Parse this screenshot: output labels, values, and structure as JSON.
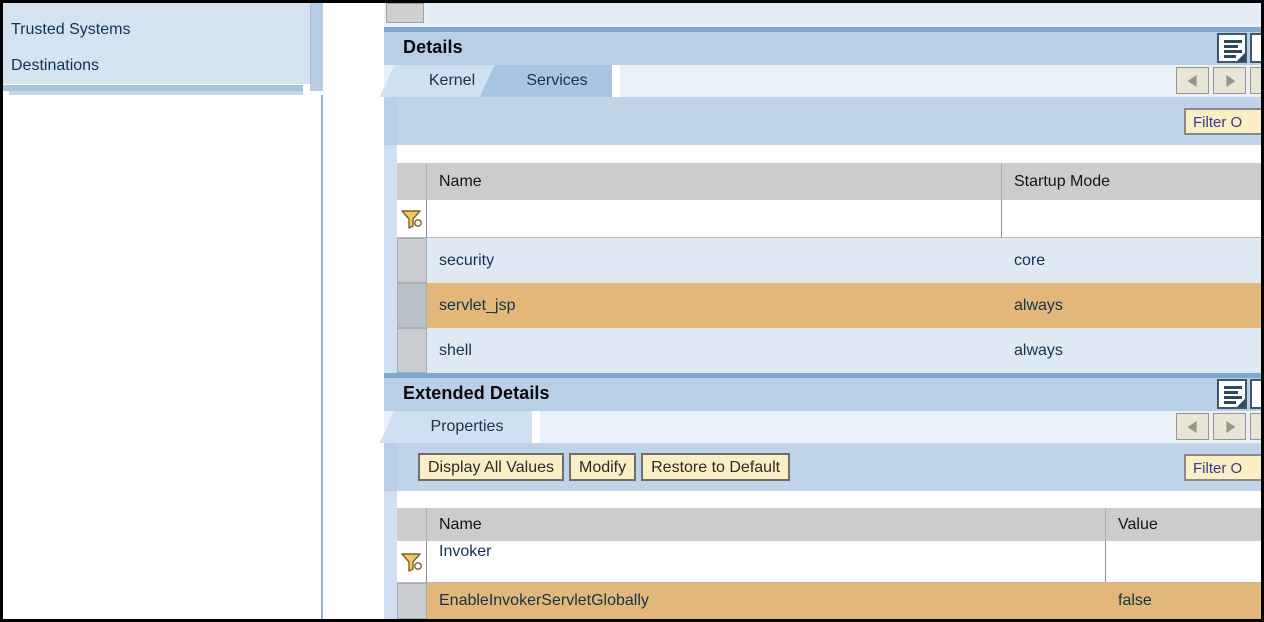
{
  "sidebar": {
    "items": [
      {
        "label": "",
        "partial": true
      },
      {
        "label": "Trusted Systems"
      },
      {
        "label": "Destinations"
      }
    ]
  },
  "details": {
    "title": "Details",
    "list_icon": "document-list-icon",
    "tabs": [
      {
        "label": "Kernel",
        "active": false
      },
      {
        "label": "Services",
        "active": true
      }
    ],
    "nav_prev_icon": "chevron-left-icon",
    "nav_next_icon": "chevron-right-icon",
    "filter_button": "Filter O",
    "table": {
      "columns": [
        "Name",
        "Startup Mode"
      ],
      "filter_row": {
        "name": "",
        "startup_mode": ""
      },
      "filter_icon": "filter-funnel-icon",
      "rows": [
        {
          "name": "security",
          "startup_mode": "core",
          "selected": false
        },
        {
          "name": "servlet_jsp",
          "startup_mode": "always",
          "selected": true
        },
        {
          "name": "shell",
          "startup_mode": "always",
          "selected": false
        }
      ]
    }
  },
  "extended_details": {
    "title": "Extended Details",
    "list_icon": "document-list-icon",
    "tabs": [
      {
        "label": "Properties",
        "active": true
      }
    ],
    "nav_prev_icon": "chevron-left-icon",
    "nav_next_icon": "chevron-right-icon",
    "filter_button": "Filter O",
    "toolbar_buttons": [
      "Display All Values",
      "Modify",
      "Restore to Default"
    ],
    "table": {
      "columns": [
        "Name",
        "Value"
      ],
      "filter_row": {
        "name": "Invoker",
        "value": ""
      },
      "filter_icon": "filter-funnel-icon",
      "rows": [
        {
          "name": "EnableInvokerServletGlobally",
          "value": "false",
          "selected": true
        }
      ]
    }
  },
  "colors": {
    "header_bar": "#b8cfe5",
    "row_normal": "#dfe9f3",
    "row_selected": "#e3b778",
    "tab_active": "#a8c6e4",
    "tab_inactive": "#cfe0f0",
    "button_yellow": "#faeec4",
    "column_header": "#cccccc",
    "separator_blue": "#7fa7cf"
  }
}
